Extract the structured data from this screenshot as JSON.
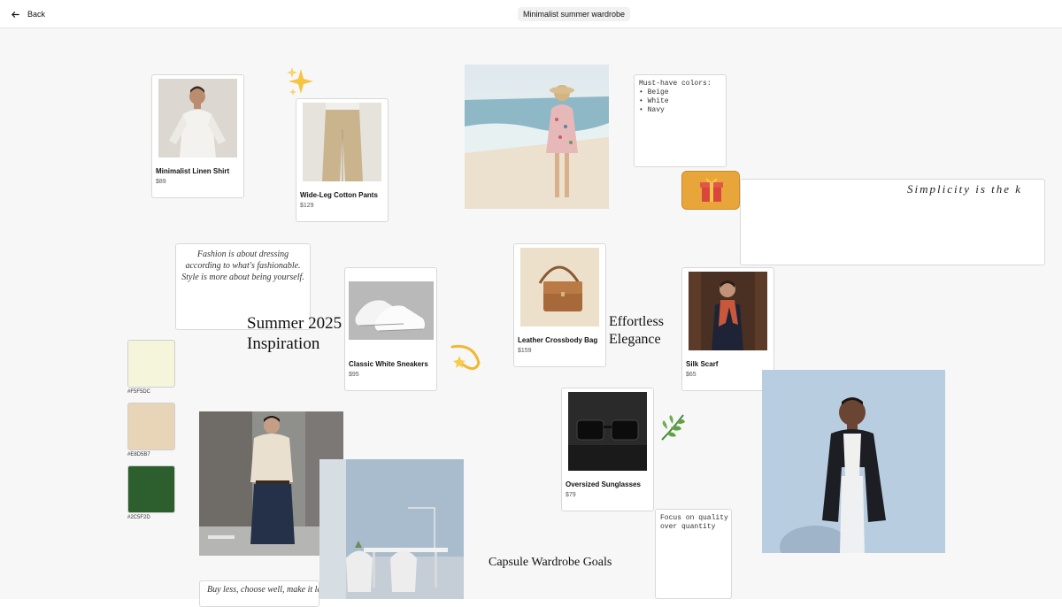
{
  "header": {
    "back_label": "Back",
    "board_title": "Minimalist summer wardrobe"
  },
  "products": [
    {
      "name": "Minimalist Linen Shirt",
      "price": "$89"
    },
    {
      "name": "Wide-Leg Cotton Pants",
      "price": "$129"
    },
    {
      "name": "Classic White Sneakers",
      "price": "$95"
    },
    {
      "name": "Leather Crossbody Bag",
      "price": "$159"
    },
    {
      "name": "Silk Scarf",
      "price": "$65"
    },
    {
      "name": "Oversized Sunglasses",
      "price": "$79"
    }
  ],
  "notes": {
    "colors": "Must-have colors:\n• Beige\n• White\n• Navy",
    "quality": "Focus on quality\nover quantity"
  },
  "quotes": {
    "fashion": "Fashion is about dressing according to what's fashionable. Style is more about being yourself.",
    "simplicity": "Simplicity is the k",
    "buy_less": "Buy less, choose well, make it la"
  },
  "text_blocks": {
    "summer": "Summer 2025\nInspiration",
    "effortless": "Effortless\nElegance",
    "capsule": "Capsule Wardrobe Goals"
  },
  "swatches": [
    {
      "hex": "#F5F5DC",
      "label": "#F5F5DC"
    },
    {
      "hex": "#E8D5B7",
      "label": "#E8D5B7"
    },
    {
      "hex": "#2C5F2D",
      "label": "#2C5F2D"
    }
  ],
  "stickers": {
    "sparkles": "sparkles-icon",
    "gift": "gift-icon",
    "shooting_star": "dizzy-icon",
    "leaf": "herb-icon"
  },
  "colors": {
    "gift_bg": "#E8A63A",
    "canvas": "#f7f7f7"
  }
}
